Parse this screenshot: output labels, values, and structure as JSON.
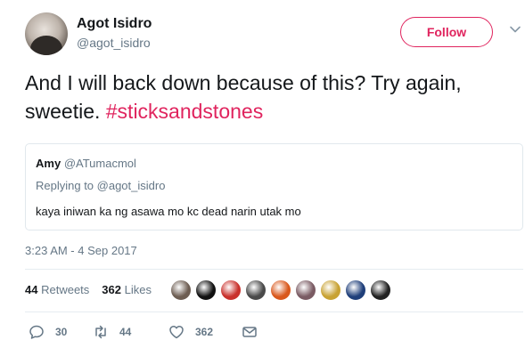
{
  "author": {
    "name": "Agot Isidro",
    "handle": "@agot_isidro",
    "follow_label": "Follow"
  },
  "tweet": {
    "text": "And I will back down because of this? Try again, sweetie. ",
    "hashtag": "#sticksandstones",
    "timestamp": "3:23 AM - 4 Sep 2017"
  },
  "quoted_tweet": {
    "name": "Amy",
    "handle": "@ATumacmol",
    "replying_to": "Replying to @agot_isidro",
    "text": "kaya iniwan ka ng asawa mo kc dead narin utak mo"
  },
  "stats": {
    "retweets_count": "44",
    "retweets_label": "Retweets",
    "likes_count": "362",
    "likes_label": "Likes"
  },
  "liker_avatars": [
    {
      "name": "liker-avatar-1",
      "color": "#6d5d52"
    },
    {
      "name": "liker-avatar-2",
      "color": "#111111"
    },
    {
      "name": "liker-avatar-3",
      "color": "#c9312c"
    },
    {
      "name": "liker-avatar-4",
      "color": "#4a4a4a"
    },
    {
      "name": "liker-avatar-5",
      "color": "#d9581c"
    },
    {
      "name": "liker-avatar-6",
      "color": "#7a5b63"
    },
    {
      "name": "liker-avatar-7",
      "color": "#c8a233"
    },
    {
      "name": "liker-avatar-8",
      "color": "#1f3f7a"
    },
    {
      "name": "liker-avatar-9",
      "color": "#222222"
    }
  ],
  "actions": {
    "reply_count": "30",
    "retweet_count": "44",
    "like_count": "362"
  },
  "colors": {
    "accent": "#e0245e",
    "secondary_text": "#657786",
    "primary_text": "#14171a",
    "border": "#e1e8ed"
  }
}
